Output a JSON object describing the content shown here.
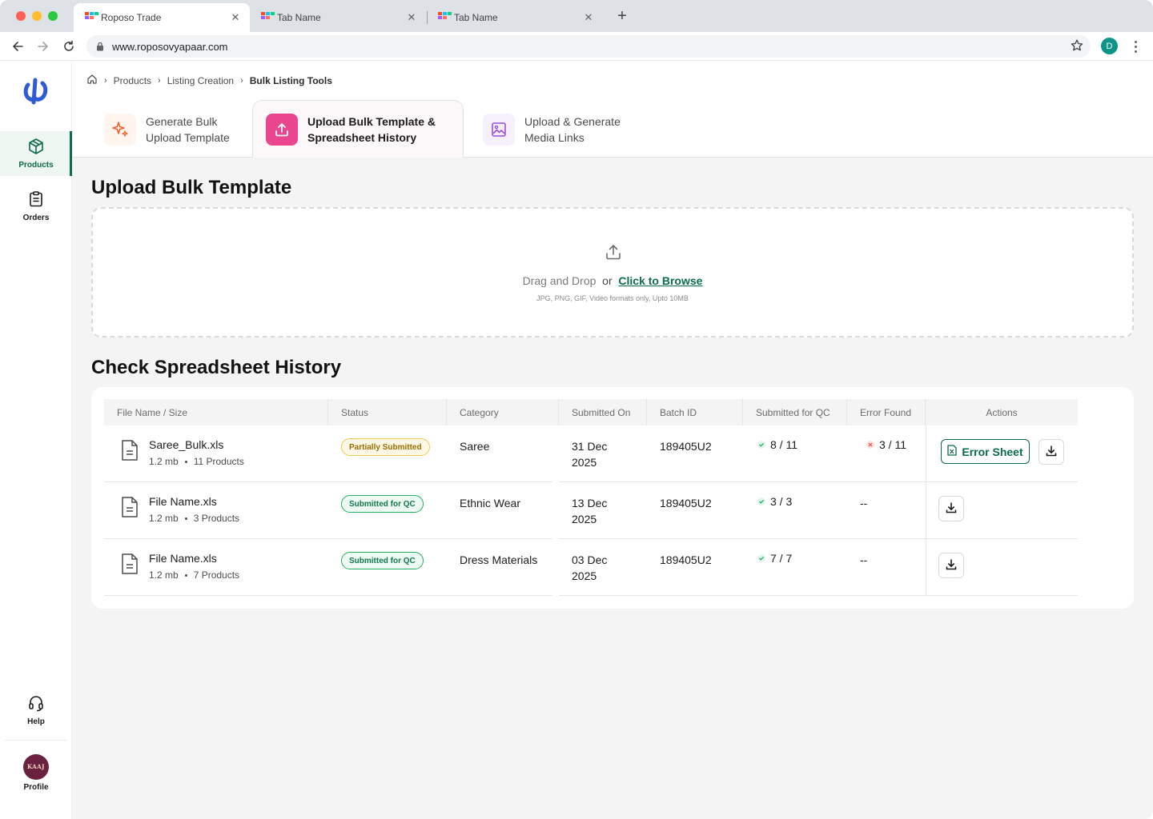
{
  "browser": {
    "tabs": [
      {
        "title": "Roposo Trade",
        "active": true
      },
      {
        "title": "Tab Name",
        "active": false
      },
      {
        "title": "Tab Name",
        "active": false
      }
    ],
    "url": "www.roposovyapaar.com",
    "profile_initial": "D"
  },
  "sidebar": {
    "items": [
      {
        "label": "Products",
        "icon": "box-icon",
        "active": true
      },
      {
        "label": "Orders",
        "icon": "clipboard-icon",
        "active": false
      }
    ],
    "help_label": "Help",
    "profile_label": "Profile",
    "avatar_text": "KAAJ"
  },
  "breadcrumb": {
    "items": [
      "Products",
      "Listing Creation"
    ],
    "current": "Bulk Listing Tools"
  },
  "tool_tabs": [
    {
      "line1": "Generate Bulk",
      "line2": "Upload Template",
      "icon": "sparkle-icon",
      "active": false
    },
    {
      "line1": "Upload Bulk Template &",
      "line2": "Spreadsheet History",
      "icon": "upload-icon",
      "active": true
    },
    {
      "line1": "Upload & Generate",
      "line2": "Media Links",
      "icon": "image-icon",
      "active": false
    }
  ],
  "upload": {
    "title": "Upload Bulk Template",
    "drag_text": "Drag and Drop",
    "or_text": "or",
    "browse_text": "Click to Browse",
    "hint": "JPG, PNG, GIF, Video formats only, Upto 10MB"
  },
  "history": {
    "title": "Check Spreadsheet History",
    "columns": [
      "File Name / Size",
      "Status",
      "Category",
      "Submitted On",
      "Batch ID",
      "Submitted for QC",
      "Error Found",
      "Actions"
    ],
    "rows": [
      {
        "file_name": "Saree_Bulk.xls",
        "size": "1.2 mb",
        "products": "11 Products",
        "status": "Partially Submitted",
        "status_type": "partial",
        "category": "Saree",
        "date_line1": "31 Dec",
        "date_line2": "2025",
        "batch_id": "189405U2",
        "qc": "8 / 11",
        "error": "3 / 11",
        "has_error": true,
        "error_sheet_label": "Error Sheet"
      },
      {
        "file_name": "File Name.xls",
        "size": "1.2 mb",
        "products": "3 Products",
        "status": "Submitted for QC",
        "status_type": "qc",
        "category": "Ethnic Wear",
        "date_line1": "13 Dec",
        "date_line2": "2025",
        "batch_id": "189405U2",
        "qc": "3 / 3",
        "error": "--",
        "has_error": false
      },
      {
        "file_name": "File Name.xls",
        "size": "1.2 mb",
        "products": "7 Products",
        "status": "Submitted for QC",
        "status_type": "qc",
        "category": "Dress Materials",
        "date_line1": "03 Dec",
        "date_line2": "2025",
        "batch_id": "189405U2",
        "qc": "7 / 7",
        "error": "--",
        "has_error": false
      }
    ]
  },
  "colors": {
    "brand_green": "#0b6b4a",
    "accent_pink": "#e9468f",
    "logo_blue": "#2f5bd6"
  }
}
